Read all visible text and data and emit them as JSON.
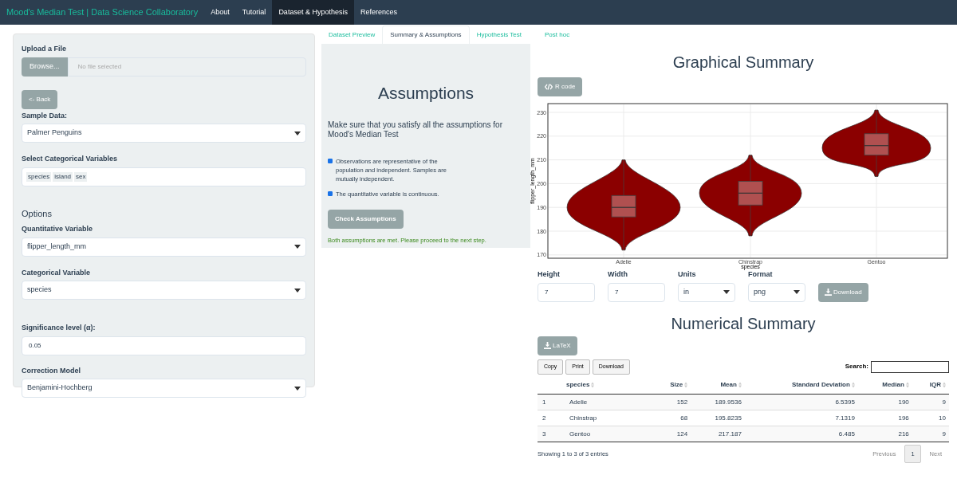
{
  "navbar": {
    "brand": "Mood's Median Test | Data Science Collaboratory",
    "items": [
      {
        "label": "About",
        "selected": false
      },
      {
        "label": "Tutorial",
        "selected": false
      },
      {
        "label": "Dataset & Hypothesis",
        "selected": true
      },
      {
        "label": "References",
        "selected": false
      }
    ]
  },
  "sidebar": {
    "upload_label": "Upload a File",
    "browse_button": "Browse...",
    "file_placeholder": "No file selected",
    "back_button": "<- Back",
    "sample_data": {
      "label": "Sample Data:",
      "value": "Palmer Penguins"
    },
    "categorical_select": {
      "label": "Select Categorical Variables",
      "tags": [
        "species",
        "island",
        "sex"
      ]
    },
    "options_heading": "Options",
    "quantitative": {
      "label": "Quantitative Variable",
      "value": "flipper_length_mm"
    },
    "categorical": {
      "label": "Categorical Variable",
      "value": "species"
    },
    "significance": {
      "label": "Significance level (α):",
      "value": "0.05"
    },
    "correction": {
      "label": "Correction Model",
      "value": "Benjamini-Hochberg"
    }
  },
  "subtabs": [
    {
      "label": "Dataset Preview",
      "selected": false
    },
    {
      "label": "Summary & Assumptions",
      "selected": true
    },
    {
      "label": "Hypothesis Test",
      "selected": false
    },
    {
      "label": "Post hoc",
      "selected": false
    }
  ],
  "assumptions": {
    "title": "Assumptions",
    "intro": "Make sure that you satisfy all the assumptions for Mood's Median Test",
    "items": [
      {
        "text": "Observations are representative of the population and independent. Samples are mutually independent.",
        "checked": true
      },
      {
        "text": "The quantitative variable is continuous.",
        "checked": true
      }
    ],
    "button": "Check Assumptions",
    "message": "Both assumptions are met. Please proceed to the next step."
  },
  "graphical": {
    "title": "Graphical Summary",
    "code_button": "R code",
    "plot": {
      "ylabel": "flipper_length_mm",
      "xlabel": "species",
      "yticks": [
        "230",
        "220",
        "210",
        "200",
        "190",
        "180",
        "170"
      ],
      "categories": [
        "Adelie",
        "Chinstrap",
        "Gentoo"
      ]
    },
    "fields": [
      {
        "kind": "input",
        "label": "Height",
        "value": "7"
      },
      {
        "kind": "input",
        "label": "Width",
        "value": "7"
      },
      {
        "kind": "select",
        "label": "Units",
        "value": "in"
      },
      {
        "kind": "select",
        "label": "Format",
        "value": "png"
      }
    ],
    "download_button": "Download"
  },
  "numerical": {
    "title": "Numerical Summary",
    "latex_button": "LaTeX",
    "table_buttons": [
      "Copy",
      "Print",
      "Download"
    ],
    "search_label": "Search:",
    "columns": [
      "",
      "species",
      "Size",
      "Mean",
      "Standard Deviation",
      "Median",
      "IQR"
    ],
    "rows": [
      [
        "1",
        "Adelie",
        "152",
        "189.9536",
        "6.5395",
        "190",
        "9"
      ],
      [
        "2",
        "Chinstrap",
        "68",
        "195.8235",
        "7.1319",
        "196",
        "10"
      ],
      [
        "3",
        "Gentoo",
        "124",
        "217.187",
        "6.485",
        "216",
        "9"
      ]
    ],
    "footer": "Showing 1 to 3 of 3 entries",
    "pagination": {
      "previous": "Previous",
      "page": "1",
      "next": "Next"
    }
  }
}
